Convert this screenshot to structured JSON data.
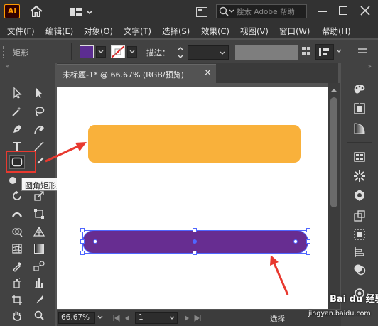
{
  "app": {
    "logo": "Ai"
  },
  "search": {
    "placeholder": "搜索 Adobe 帮助"
  },
  "menu": [
    {
      "label": "文件(F)"
    },
    {
      "label": "编辑(E)"
    },
    {
      "label": "对象(O)"
    },
    {
      "label": "文字(T)"
    },
    {
      "label": "选择(S)"
    },
    {
      "label": "效果(C)"
    },
    {
      "label": "视图(V)"
    },
    {
      "label": "窗口(W)"
    },
    {
      "label": "帮助(H)"
    }
  ],
  "control": {
    "selection_label": "矩形",
    "stroke_label": "描边："
  },
  "document": {
    "tab_title": "未标题-1* @ 66.67% (RGB/预览)",
    "close": "×"
  },
  "tooltip": {
    "text": "圆角矩形工具"
  },
  "status": {
    "zoom": "66.67%",
    "page": "1",
    "mode": "选择"
  },
  "watermark": {
    "title": "Bai du 经验",
    "url": "jingyan.baidu.com"
  },
  "colors": {
    "fill": "#5c2d91",
    "orange_rect": "#f9b13b",
    "purple_rect": "#672d91",
    "selection": "#4f66ff",
    "arrow": "#e8392f",
    "highlight": "#e8392f"
  },
  "icons": {
    "left_tools": [
      "selection-arrow",
      "direct-selection",
      "magic-wand",
      "lasso",
      "pen",
      "curvature",
      "type",
      "line-segment",
      "rounded-rectangle",
      "paintbrush",
      "ellipse",
      "pencil",
      "rotate",
      "scale",
      "width",
      "free-transform",
      "shape-builder",
      "perspective-grid",
      "mesh",
      "gradient",
      "eyedropper",
      "blend",
      "symbol-sprayer",
      "column-graph",
      "artboard",
      "slice",
      "hand",
      "zoom"
    ],
    "right_tools": [
      "color",
      "color-guide",
      "gradient-panel",
      "swatches",
      "brushes",
      "symbols",
      "transform",
      "align",
      "pathfinder",
      "transparency",
      "appearance"
    ]
  }
}
